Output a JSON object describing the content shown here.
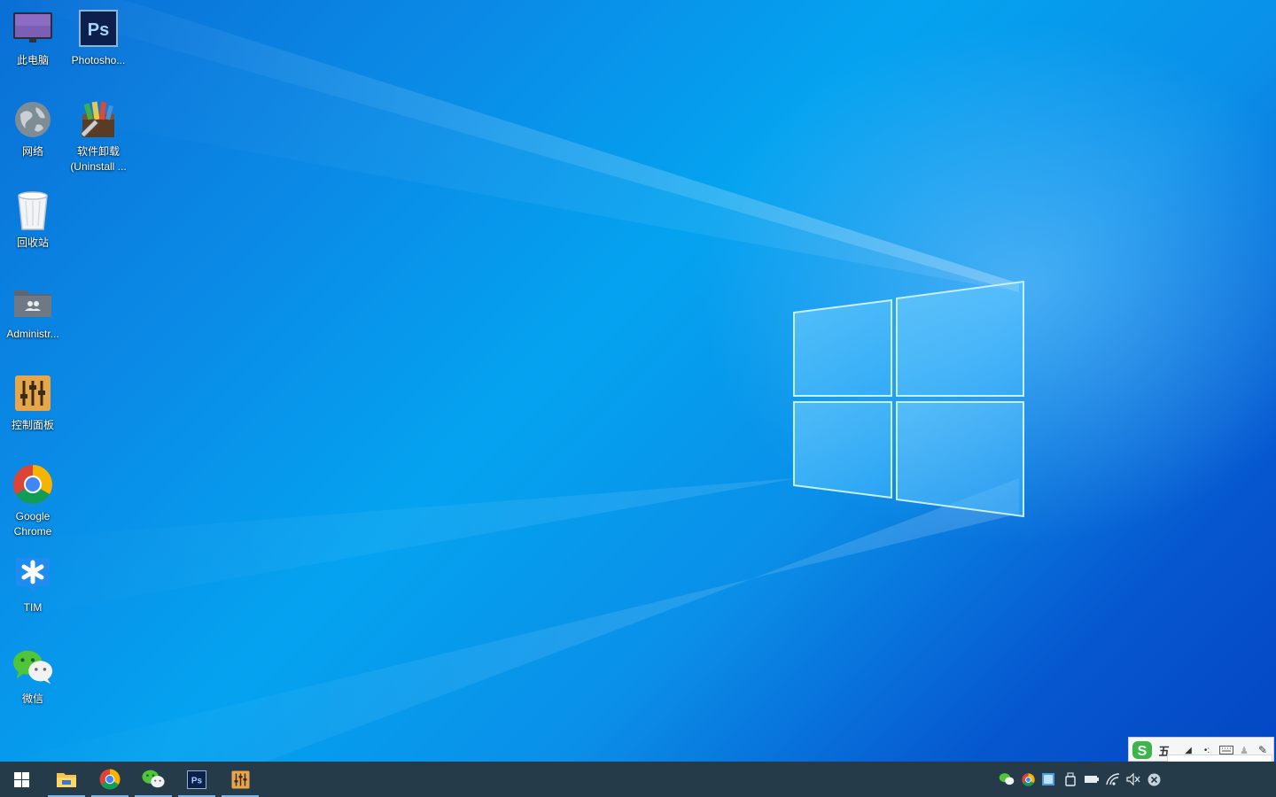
{
  "desktop": {
    "icons": [
      {
        "label": "此电脑",
        "icon": "computer-icon"
      },
      {
        "label": "Photosho...",
        "icon": "photoshop-icon"
      },
      {
        "label": "网络",
        "icon": "network-icon"
      },
      {
        "label": "软件卸载\n(Uninstall ...",
        "icon": "uninstall-icon"
      },
      {
        "label": "回收站",
        "icon": "recycle-bin-icon"
      },
      {
        "label": "Administr...",
        "icon": "user-folder-icon"
      },
      {
        "label": "控制面板",
        "icon": "control-panel-icon"
      },
      {
        "label": "Google Chrome",
        "icon": "chrome-icon"
      },
      {
        "label": "TIM",
        "icon": "tim-icon"
      },
      {
        "label": "微信",
        "icon": "wechat-icon"
      }
    ]
  },
  "taskbar": {
    "pinned": [
      {
        "name": "file-explorer",
        "icon": "folder-icon",
        "running": true
      },
      {
        "name": "chrome",
        "icon": "chrome-icon",
        "running": true
      },
      {
        "name": "wechat",
        "icon": "wechat-icon",
        "running": true
      },
      {
        "name": "photoshop",
        "icon": "photoshop-icon",
        "running": true,
        "text": "Ps"
      },
      {
        "name": "control-panel",
        "icon": "control-panel-icon",
        "running": true
      }
    ],
    "tray": [
      "wechat-tray-icon",
      "chrome-tray-icon",
      "network-drive-icon",
      "usb-icon",
      "battery-icon",
      "wifi-icon",
      "mute-icon",
      "close-circle-icon"
    ]
  },
  "ime": {
    "mode": "五",
    "logo": "S"
  },
  "colors": {
    "taskbar": "#253b4a",
    "accent": "#78b8ee",
    "photoshop": "#0d1f4b",
    "photoshop_text": "#31a8ff"
  }
}
